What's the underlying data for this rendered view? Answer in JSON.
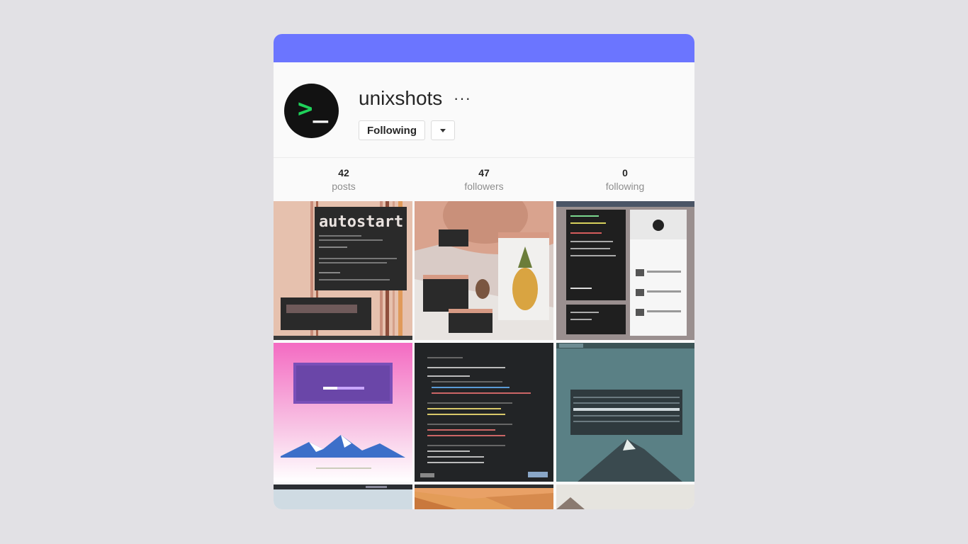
{
  "profile": {
    "username": "unixshots",
    "more_glyph": "···",
    "avatar_prompt_symbol": ">",
    "avatar_prompt_cursor": "_",
    "follow_button_label": "Following",
    "accent_color": "#6b75ff",
    "avatar_prompt_color": "#1fd15a"
  },
  "stats": [
    {
      "value": "42",
      "label": "posts"
    },
    {
      "value": "47",
      "label": "followers"
    },
    {
      "value": "0",
      "label": "following"
    }
  ],
  "posts": {
    "autostart_heading": "autostart"
  },
  "icons": {
    "more": "more-options-icon",
    "dropdown": "chevron-down-icon"
  }
}
